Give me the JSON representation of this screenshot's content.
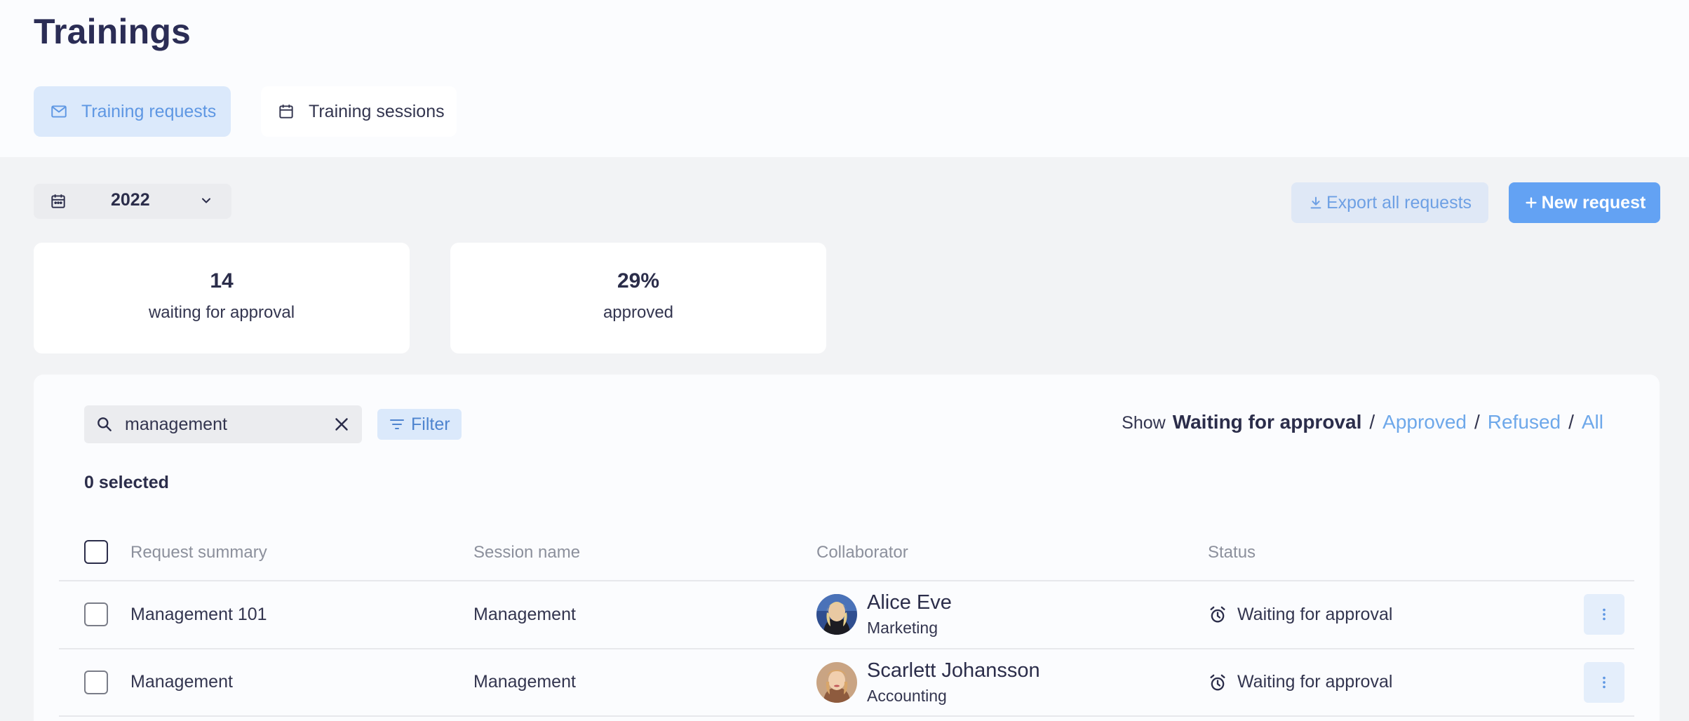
{
  "page": {
    "title": "Trainings"
  },
  "tabs": [
    {
      "label": "Training requests",
      "icon": "mail-icon",
      "active": true
    },
    {
      "label": "Training sessions",
      "icon": "calendar-icon",
      "active": false
    }
  ],
  "year_filter": {
    "value": "2022",
    "icon": "calendar-icon"
  },
  "actions": {
    "export_label": "Export all requests",
    "new_label": "New request"
  },
  "stats": [
    {
      "value": "14",
      "label": "waiting for approval"
    },
    {
      "value": "29%",
      "label": "approved"
    }
  ],
  "search": {
    "value": "management",
    "placeholder": ""
  },
  "filter_label": "Filter",
  "show": {
    "label": "Show",
    "active": "Waiting for approval",
    "options": [
      "Approved",
      "Refused",
      "All"
    ]
  },
  "selection": {
    "text": "0 selected"
  },
  "table": {
    "columns": [
      "Request summary",
      "Session name",
      "Collaborator",
      "Status"
    ],
    "rows": [
      {
        "summary": "Management 101",
        "session": "Management",
        "collaborator": "Alice Eve",
        "department": "Marketing",
        "status": "Waiting for approval"
      },
      {
        "summary": "Management",
        "session": "Management",
        "collaborator": "Scarlett Johansson",
        "department": "Accounting",
        "status": "Waiting for approval"
      }
    ]
  },
  "colors": {
    "accent": "#63a2f3",
    "accent_soft": "#dbe9fb",
    "text": "#2b2d4a",
    "link": "#6ea8ea"
  }
}
